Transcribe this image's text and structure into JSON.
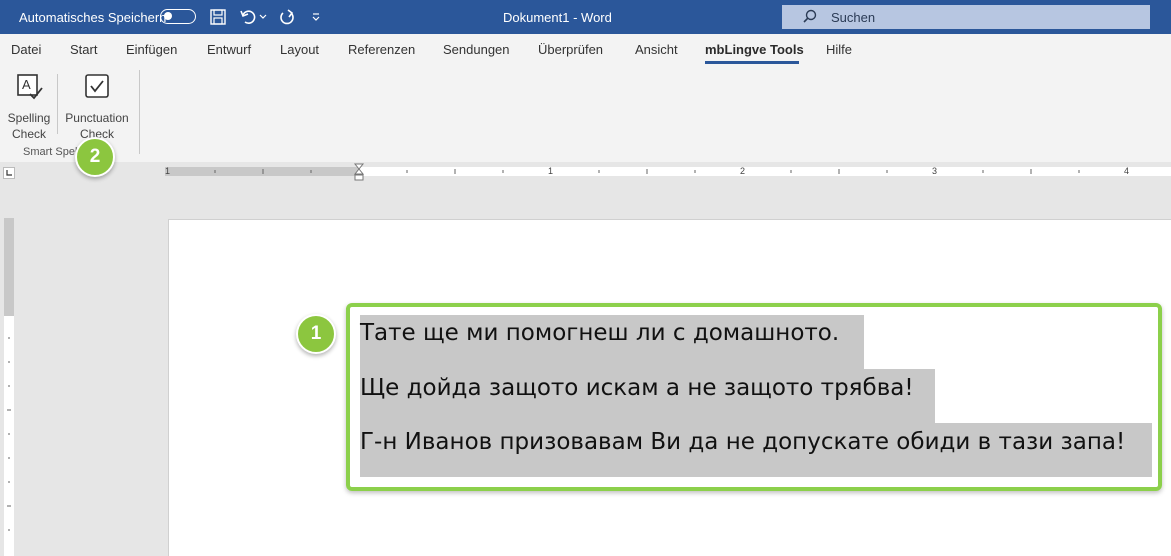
{
  "titlebar": {
    "autosave_label": "Automatisches Speichern",
    "autosave_state": "off",
    "document_title": "Dokument1  -  Word",
    "search_placeholder": "Suchen"
  },
  "tabs": [
    {
      "label": "Datei"
    },
    {
      "label": "Start"
    },
    {
      "label": "Einfügen"
    },
    {
      "label": "Entwurf"
    },
    {
      "label": "Layout"
    },
    {
      "label": "Referenzen"
    },
    {
      "label": "Sendungen"
    },
    {
      "label": "Überprüfen"
    },
    {
      "label": "Ansicht"
    },
    {
      "label": "mbLingve Tools",
      "active": true
    },
    {
      "label": "Hilfe"
    }
  ],
  "ribbon": {
    "spelling_line1": "Spelling",
    "spelling_line2": "Check",
    "punctuation_line1": "Punctuation",
    "punctuation_line2": "Check",
    "group_label": "Smart Spell"
  },
  "ruler": {
    "numbers": [
      "1",
      "1",
      "2",
      "3",
      "4"
    ]
  },
  "document": {
    "lines": [
      "Тате ще ми помогнеш ли с домашното.",
      "Ще дойда защото искам а не защото трябва!",
      "Г-н Иванов призовавам Ви да не допускате обиди в тази запа!"
    ]
  },
  "badges": {
    "one": "1",
    "two": "2"
  },
  "colors": {
    "titlebar": "#2b579a",
    "highlight": "#c8c8c8",
    "callout_green": "#8cd04b",
    "badge_green": "#8cc63f"
  }
}
